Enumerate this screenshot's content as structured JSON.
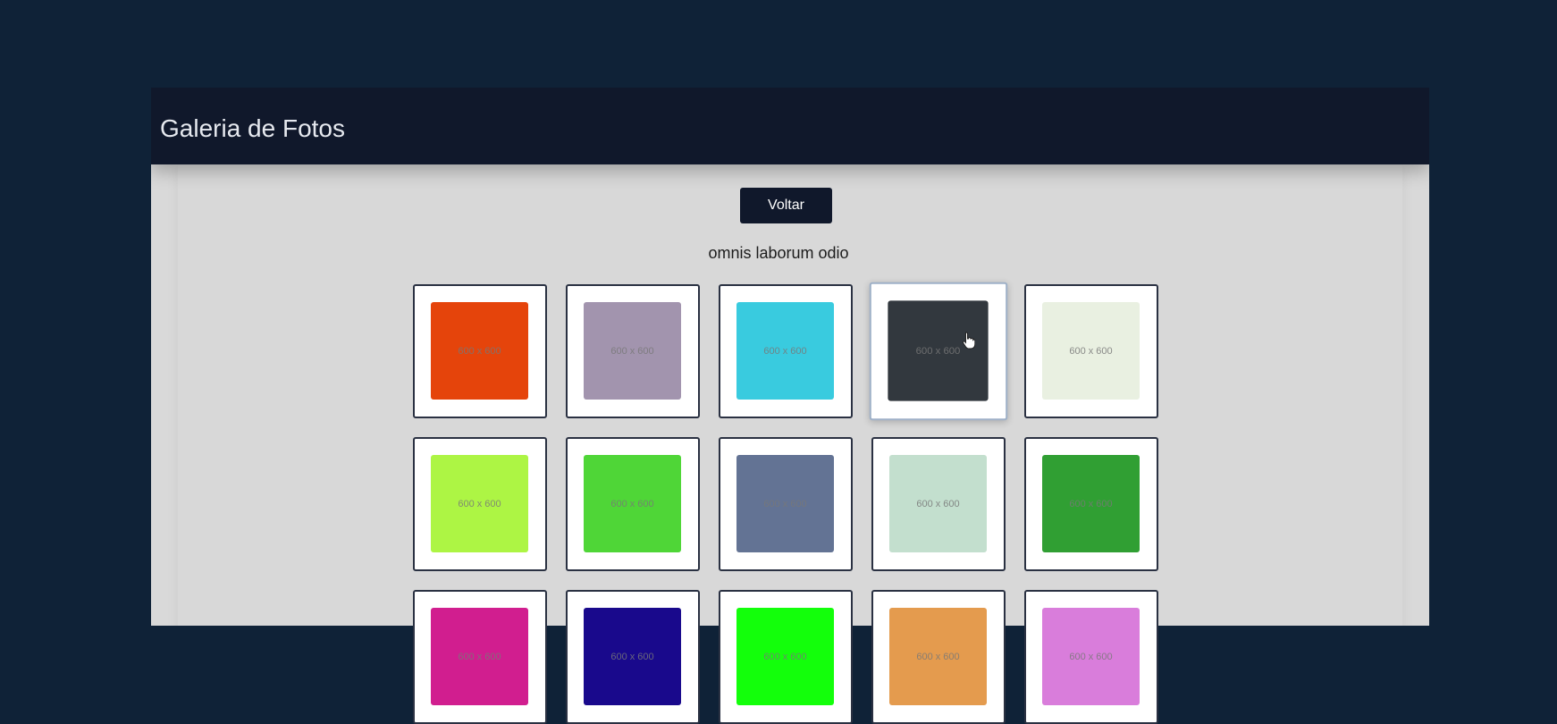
{
  "header": {
    "title": "Galeria de Fotos"
  },
  "actions": {
    "back_label": "Voltar"
  },
  "album": {
    "title": "omnis laborum odio"
  },
  "photos": [
    {
      "color": "#e5440b",
      "label": "600 x 600"
    },
    {
      "color": "#a294ae",
      "label": "600 x 600"
    },
    {
      "color": "#39cbdf",
      "label": "600 x 600"
    },
    {
      "color": "#32383e",
      "label": "600 x 600",
      "hovered": true
    },
    {
      "color": "#e9f0e1",
      "label": "600 x 600"
    },
    {
      "color": "#adf544",
      "label": "600 x 600"
    },
    {
      "color": "#4fd637",
      "label": "600 x 600"
    },
    {
      "color": "#637394",
      "label": "600 x 600"
    },
    {
      "color": "#c3dfce",
      "label": "600 x 600"
    },
    {
      "color": "#309f33",
      "label": "600 x 600"
    },
    {
      "color": "#d11e8f",
      "label": "600 x 600"
    },
    {
      "color": "#19098c",
      "label": "600 x 600"
    },
    {
      "color": "#13ff0b",
      "label": "600 x 600"
    },
    {
      "color": "#e49b4e",
      "label": "600 x 600"
    },
    {
      "color": "#d97ddb",
      "label": "600 x 600"
    }
  ]
}
